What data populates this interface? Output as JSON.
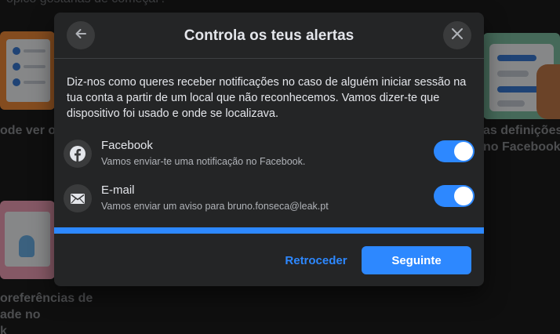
{
  "background": {
    "top_text": "ópico gostarias de começar?",
    "left_1": "ode ver o",
    "left_2_lines": [
      "oreferências de",
      "ade no",
      "k"
    ],
    "right_1_lines": [
      "as definições",
      "no Facebook"
    ]
  },
  "modal": {
    "title": "Controla os teus alertas",
    "back_icon": "arrow-left-icon",
    "close_icon": "close-icon",
    "description": "Diz-nos como queres receber notificações no caso de alguém iniciar sessão na tua conta a partir de um local que não reconhecemos. Vamos dizer-te que dispositivo foi usado e onde se localizava.",
    "options": [
      {
        "icon": "facebook-icon",
        "title": "Facebook",
        "subtitle": "Vamos enviar-te uma notificação no Facebook.",
        "enabled": true
      },
      {
        "icon": "email-icon",
        "title": "E-mail",
        "subtitle": "Vamos enviar um aviso para bruno.fonseca@leak.pt",
        "enabled": true
      }
    ],
    "progress": 1.0,
    "back_label": "Retroceder",
    "next_label": "Seguinte"
  },
  "colors": {
    "accent": "#2d88ff",
    "modal_bg": "#242526",
    "surface": "#3a3b3c"
  }
}
